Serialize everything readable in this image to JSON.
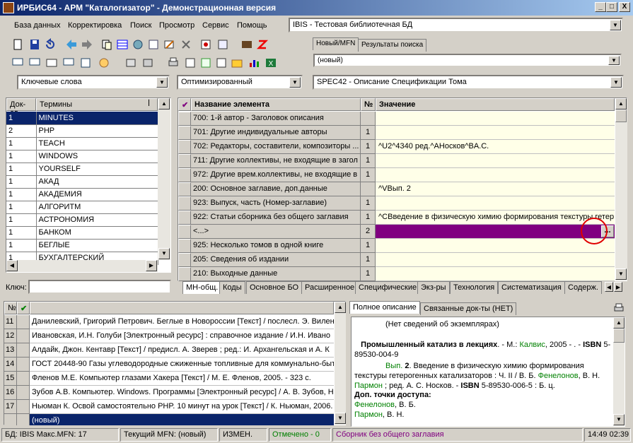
{
  "window": {
    "title": "ИРБИС64 - АРМ \"Каталогизатор\" - Демонстрационная версия",
    "btn_min": "_",
    "btn_max": "□",
    "btn_close": "X"
  },
  "menu": [
    "База данных",
    "Корректировка",
    "Поиск",
    "Просмотр",
    "Сервис",
    "Помощь"
  ],
  "db_combo": "IBIS - Тестовая библиотечная БД",
  "top_tabs": [
    "Новый/MFN",
    "Результаты поиска"
  ],
  "new_combo": "(новый)",
  "filters": {
    "dict": "Ключевые слова",
    "mode": "Оптимизированный",
    "worksheet": "SPEC42 - Описание Спецификации Тома"
  },
  "dict": {
    "headers": [
      "Док-ов",
      "Термины"
    ],
    "rows": [
      [
        "1",
        "MINUTES"
      ],
      [
        "2",
        "PHP"
      ],
      [
        "1",
        "TEACH"
      ],
      [
        "1",
        "WINDOWS"
      ],
      [
        "1",
        "YOURSELF"
      ],
      [
        "1",
        "АКАД"
      ],
      [
        "1",
        "АКАДЕМИЯ"
      ],
      [
        "1",
        "АЛГОРИТМ"
      ],
      [
        "1",
        "АСТРОНОМИЯ"
      ],
      [
        "1",
        "БАНКОМ"
      ],
      [
        "1",
        "БЕГЛЫЕ"
      ],
      [
        "1",
        "БУХГАЛТЕРСКИЙ"
      ]
    ],
    "key_label": "Ключ:"
  },
  "editor": {
    "headers": [
      "Название элемента",
      "№",
      "Значение"
    ],
    "rows": [
      [
        "700: 1-й автор - Заголовок описания",
        "",
        ""
      ],
      [
        "701: Другие индивидуальные авторы",
        "1",
        ""
      ],
      [
        "702: Редакторы, составители, композиторы ...",
        "1",
        "^U2^4340 ред.^AНосков^BА.С."
      ],
      [
        "711: Другие коллективы, не входящие в загол",
        "1",
        ""
      ],
      [
        "972: Другие врем.коллективы, не входящие в",
        "1",
        ""
      ],
      [
        "200: Основное заглавие, доп.данные",
        "",
        "^VВып. 2"
      ],
      [
        "923: Выпуск, часть (Номер-заглавие)",
        "1",
        ""
      ],
      [
        "922: Статьи сборника без общего заглавия",
        "1",
        "^CВведение в физическую химию формирования текстуры гетер"
      ],
      [
        "<...>",
        "2",
        ""
      ],
      [
        "925: Несколько томов в одной книге",
        "1",
        ""
      ],
      [
        "205: Сведения об издании",
        "1",
        ""
      ],
      [
        "210: Выходные данные",
        "1",
        ""
      ]
    ],
    "ellipsis": "...",
    "tabs": [
      "МН-общ.",
      "Коды",
      "Основное БО",
      "Расширенное",
      "Специфические",
      "Экз-ры",
      "Технология",
      "Систематизация",
      "Содерж."
    ]
  },
  "records": {
    "headers": [
      "№"
    ],
    "rows": [
      [
        "11",
        "Данилевский, Григорий Петрович. Беглые в Новороссии [Текст] / послесл. Э. Вилен"
      ],
      [
        "12",
        "Ивановская, И.Н. Голуби [Электронный ресурс] : справочное издание / И.Н. Ивано"
      ],
      [
        "13",
        "Алдайк, Джон. Кентавр [Текст] / предисл. А. Зверев ; ред.: И. Архангельская и А. К"
      ],
      [
        "14",
        "ГОСТ 20448-90 Газы углеводородные сжиженные топливные для коммунально-быт"
      ],
      [
        "15",
        "Фленов М.Е. Компьютер глазами Хакера [Текст] / М. Е. Фленов, 2005. - 323 с."
      ],
      [
        "16",
        "Зубов А.В. Компьютер. Windows. Программы [Электронный ресурс] / А. В. Зубов, Н"
      ],
      [
        "17",
        "Ньюман К. Освой самостоятельно PHP. 10 минут на урок [Текст] / К. Ньюман, 2006."
      ],
      [
        "",
        "(новый)"
      ]
    ]
  },
  "description": {
    "tabs": [
      "Полное описание",
      "Связанные док-ты (НЕТ)"
    ],
    "no_copies": "(Нет сведений об экземплярах)",
    "p1a": "Промышленный катализ в лекциях",
    "p1b": ". - М.: ",
    "p1c": "Калвис",
    "p1d": ", 2005 - . - ",
    "p1e": "ISBN",
    "p1f": " 5-89530-004-9",
    "p2a": "Вып. ",
    "p2b": "2",
    "p2c": ". Введение в физическую химию формирования текстуры гетерогенных катализаторов : Ч. II / В. Б. ",
    "p2d": "Фенелонов",
    "p2e": ", В. Н. ",
    "p2f": "Пармон",
    "p2g": " ; ред. А. С. Носков. - ",
    "p2h": "ISBN",
    "p2i": " 5-89530-006-5 : Б. ц.",
    "access": "Доп. точки доступа:",
    "a1": "Фенелонов",
    "a1b": ", В. Б.",
    "a2": "Пармон",
    "a2b": ", В. Н."
  },
  "status": {
    "db": "БД: IBIS Макс.MFN: 17",
    "mfn": "Текущий MFN: (новый)",
    "changed": "ИЗМЕН.",
    "marked": "Отмечено - 0",
    "hint": "Сборник без общего заглавия",
    "time": "14:49  02:39"
  },
  "colors": {
    "accent": "#0a246a",
    "selected_value": "#800080",
    "value_bg": "#ffffe8",
    "highlight_circle": "#e00000"
  }
}
